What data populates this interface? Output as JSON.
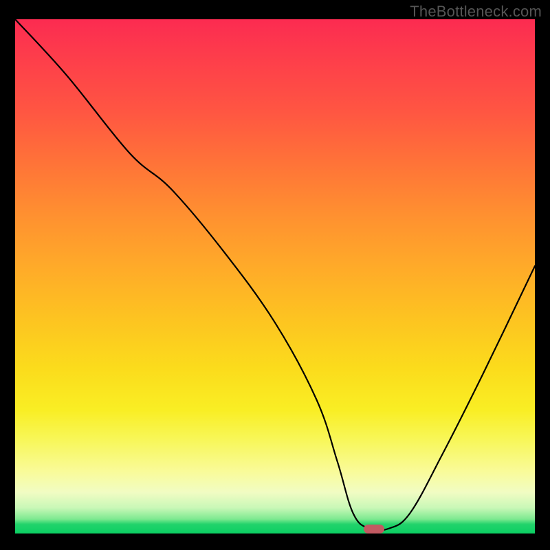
{
  "watermark": "TheBottleneck.com",
  "chart_data": {
    "type": "line",
    "title": "",
    "xlabel": "",
    "ylabel": "",
    "xlim": [
      0,
      100
    ],
    "ylim": [
      0,
      100
    ],
    "x": [
      0,
      10,
      22,
      30,
      40,
      50,
      58,
      62,
      65,
      68,
      72,
      76,
      82,
      90,
      100
    ],
    "values": [
      100,
      89,
      74,
      67,
      55,
      41,
      26,
      14,
      4,
      1,
      1,
      4,
      15,
      31,
      52
    ],
    "series_name": "bottleneck-curve",
    "marker": {
      "x": 69,
      "y": 0.8
    },
    "background_gradient": {
      "direction": "vertical",
      "stops": [
        {
          "pos": 0,
          "color": "#fc2b51"
        },
        {
          "pos": 18,
          "color": "#ff5642"
        },
        {
          "pos": 38,
          "color": "#ff9030"
        },
        {
          "pos": 58,
          "color": "#fdc321"
        },
        {
          "pos": 76,
          "color": "#f9ee24"
        },
        {
          "pos": 88,
          "color": "#f9fb9a"
        },
        {
          "pos": 95,
          "color": "#c9f8b7"
        },
        {
          "pos": 100,
          "color": "#0bcf63"
        }
      ]
    }
  }
}
